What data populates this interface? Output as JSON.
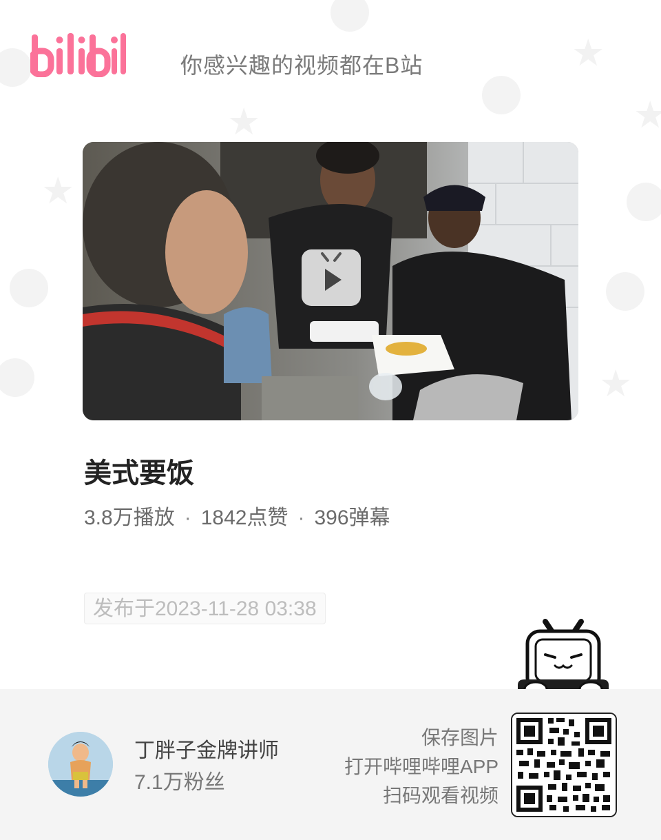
{
  "header": {
    "logo_text": "bilibili",
    "tagline": "你感兴趣的视频都在B站"
  },
  "video": {
    "title": "美式要饭",
    "stats": {
      "plays": "3.8万播放",
      "likes": "1842点赞",
      "danmaku": "396弹幕",
      "separator": "·"
    },
    "published": "发布于2023-11-28 03:38"
  },
  "author": {
    "name": "丁胖子金牌讲师",
    "fans": "7.1万粉丝"
  },
  "cta": {
    "save": "保存图片",
    "open_app": "打开哔哩哔哩APP",
    "scan": "扫码观看视频"
  },
  "colors": {
    "brand_pink": "#fb7299",
    "footer_bg": "#f4f4f4"
  },
  "icons": {
    "play": "play-icon",
    "mascot": "tv-mascot-icon",
    "qr": "qr-code"
  }
}
